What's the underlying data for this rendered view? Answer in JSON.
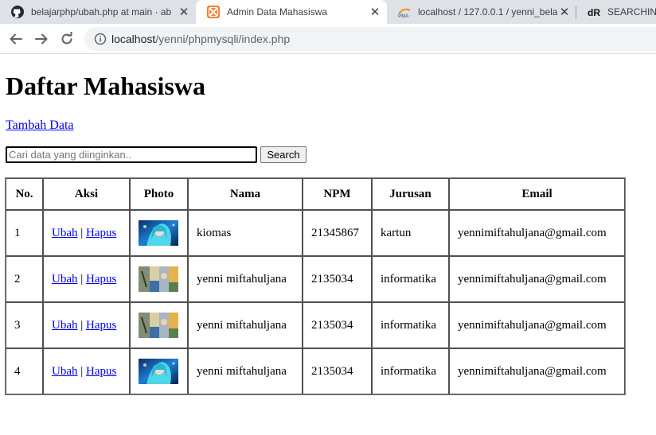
{
  "browser": {
    "tabs": [
      {
        "title": "belajarphp/ubah.php at main · ab",
        "icon": "github-icon",
        "active": false
      },
      {
        "title": "Admin Data Mahasiswa",
        "icon": "xampp-icon",
        "active": true
      },
      {
        "title": "localhost / 127.0.0.1 / yenni_bela",
        "icon": "phpmyadmin-icon",
        "active": false
      },
      {
        "title": "SEARCHING",
        "icon": "dr-icon",
        "active": false
      }
    ],
    "url_host": "localhost",
    "url_path": "/yenni/phpmysqli/index.php"
  },
  "page": {
    "title": "Daftar Mahasiswa",
    "add_link": "Tambah Data",
    "search": {
      "placeholder": "Cari data yang diinginkan..",
      "value": "",
      "button": "Search"
    },
    "table": {
      "headers": [
        "No.",
        "Aksi",
        "Photo",
        "Nama",
        "NPM",
        "Jurusan",
        "Email"
      ],
      "edit_label": "Ubah",
      "separator": "|",
      "delete_label": "Hapus",
      "rows": [
        {
          "no": "1",
          "photo": "anime-girl-blue",
          "nama": "kiomas",
          "npm": "21345867",
          "jurusan": "kartun",
          "email": "yennimiftahuljana@gmail.com"
        },
        {
          "no": "2",
          "photo": "collage-photo",
          "nama": "yenni miftahuljana",
          "npm": "2135034",
          "jurusan": "informatika",
          "email": "yennimiftahuljana@gmail.com"
        },
        {
          "no": "3",
          "photo": "collage-photo",
          "nama": "yenni miftahuljana",
          "npm": "2135034",
          "jurusan": "informatika",
          "email": "yennimiftahuljana@gmail.com"
        },
        {
          "no": "4",
          "photo": "anime-girl-blue",
          "nama": "yenni miftahuljana",
          "npm": "2135034",
          "jurusan": "informatika",
          "email": "yennimiftahuljana@gmail.com"
        }
      ]
    }
  },
  "colors": {
    "link": "#0000ee",
    "tabstrip": "#dee1e6",
    "omnibox": "#f1f3f4"
  }
}
